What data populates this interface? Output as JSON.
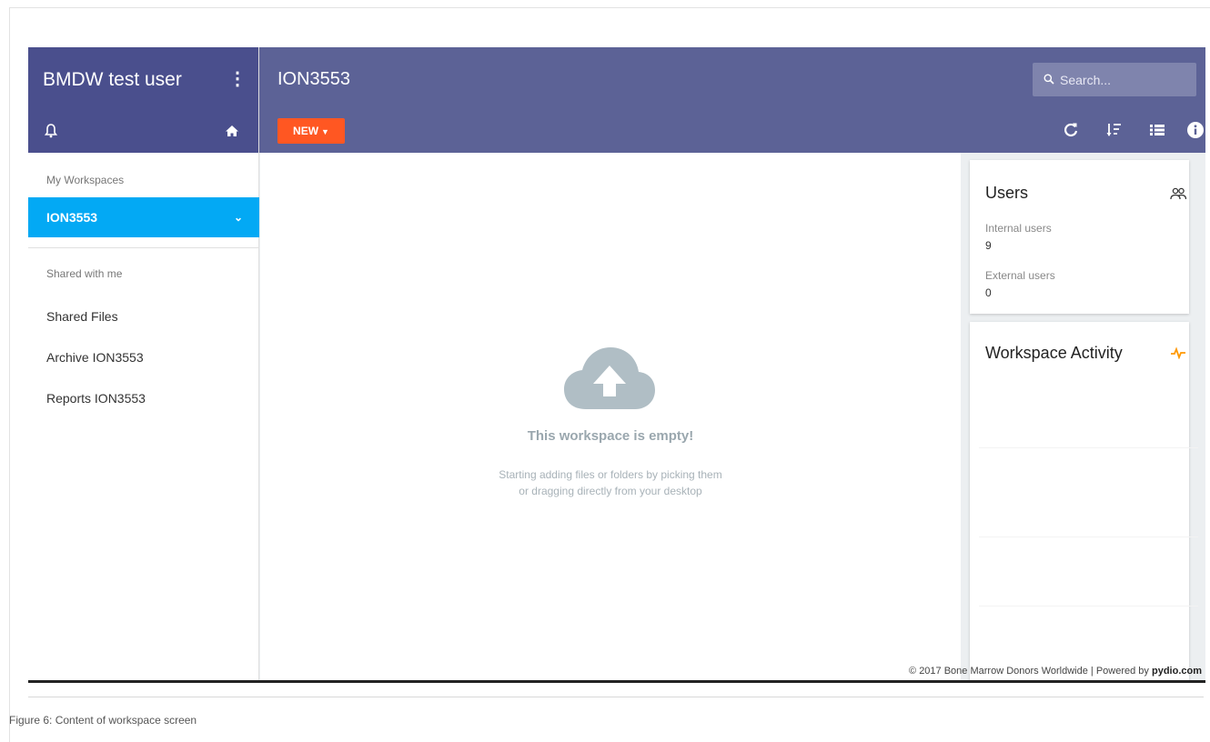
{
  "sidebar": {
    "user_name": "BMDW test user",
    "menu_icon": "more-vertical-icon",
    "notifications_icon": "bell-icon",
    "home_icon": "home-icon",
    "workspaces_label": "My Workspaces",
    "active_workspace": "ION3553",
    "shared_label": "Shared with me",
    "links": [
      "Shared Files",
      "Archive ION3553",
      "Reports ION3553"
    ]
  },
  "header": {
    "workspace_title": "ION3553",
    "search_placeholder": "Search...",
    "new_label": "NEW",
    "toolbar_icons": [
      "refresh-icon",
      "sort-icon",
      "list-view-icon",
      "info-icon"
    ]
  },
  "main": {
    "empty_icon": "cloud-upload-icon",
    "empty_title": "This workspace is empty!",
    "empty_line1": "Starting adding files or folders by picking them",
    "empty_line2": "or dragging directly from your desktop"
  },
  "users_card": {
    "title": "Users",
    "icon": "users-icon",
    "internal_label": "Internal users",
    "internal_value": "9",
    "external_label": "External users",
    "external_value": "0"
  },
  "activity_card": {
    "title": "Workspace Activity",
    "icon": "activity-icon"
  },
  "footer": {
    "text": "© 2017 Bone Marrow Donors Worldwide | Powered by",
    "brand": "pydio.com"
  },
  "caption": "Figure 6: Content of workspace screen",
  "colors": {
    "sidebar_header": "#4a4f8d",
    "app_header": "#5c6296",
    "active_item": "#03a9f4",
    "new_button": "#ff5722",
    "activity_accent": "#ff9800"
  }
}
